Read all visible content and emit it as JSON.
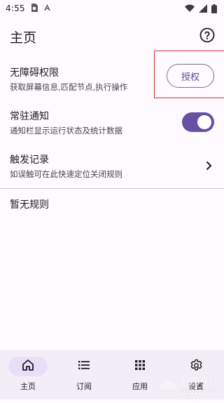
{
  "status_bar": {
    "time": "4:55"
  },
  "header": {
    "title": "主页"
  },
  "accessibility": {
    "title": "无障碍权限",
    "subtitle": "获取屏幕信息,匹配节点,执行操作",
    "grant_label": "授权"
  },
  "notification": {
    "title": "常驻通知",
    "subtitle": "通知栏显示运行状态及统计数据",
    "enabled": true
  },
  "records": {
    "title": "触发记录",
    "subtitle": "如误触可在此快速定位关闭规则"
  },
  "empty_state": "暂无规则",
  "bottom_nav": {
    "items": [
      {
        "label": "主页",
        "icon": "home-icon",
        "active": true
      },
      {
        "label": "订阅",
        "icon": "list-icon",
        "active": false
      },
      {
        "label": "应用",
        "icon": "apps-grid-icon",
        "active": false
      },
      {
        "label": "设置",
        "icon": "gear-icon",
        "active": false
      }
    ]
  },
  "watermark": {
    "text": "1999软件站",
    "sub": "1999luyou.com"
  },
  "colors": {
    "accent": "#6750a4",
    "highlight_box": "#d32f2f",
    "nav_background": "#f3edf7",
    "nav_active_pill": "#e8def8"
  }
}
